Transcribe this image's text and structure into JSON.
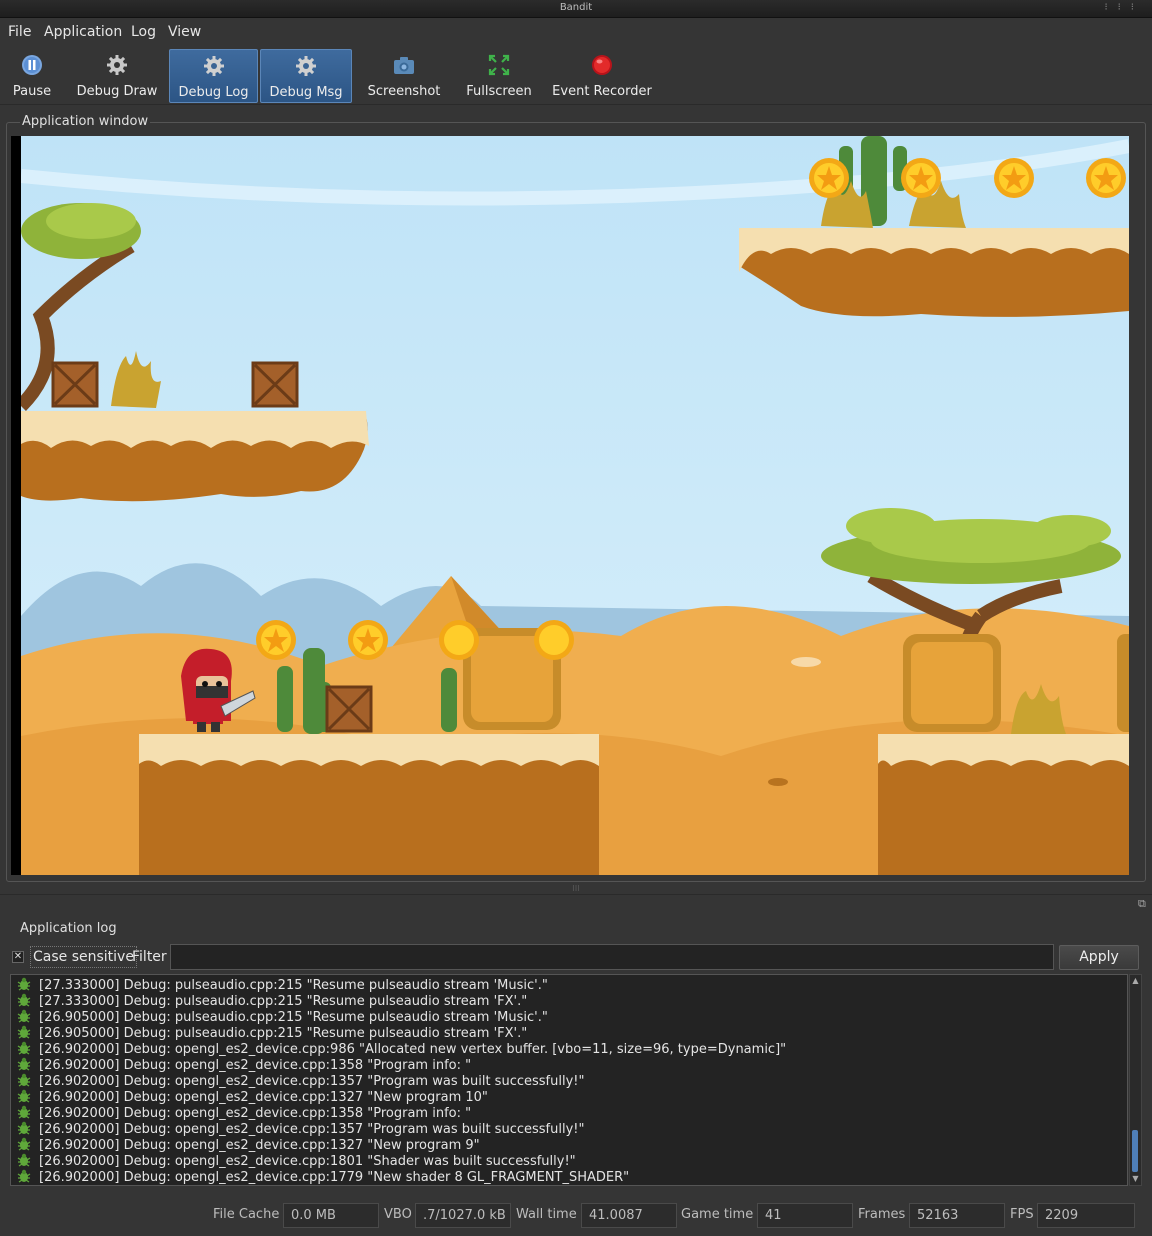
{
  "window": {
    "title": "Bandit"
  },
  "menu": [
    "File",
    "Application",
    "Log",
    "View"
  ],
  "toolbar": [
    {
      "label": "Pause",
      "icon": "pause-icon",
      "active": false
    },
    {
      "label": "Debug Draw",
      "icon": "gear-icon",
      "active": false
    },
    {
      "label": "Debug Log",
      "icon": "gear-icon",
      "active": true
    },
    {
      "label": "Debug Msg",
      "icon": "gear-icon",
      "active": true
    },
    {
      "label": "Screenshot",
      "icon": "camera-icon",
      "active": false
    },
    {
      "label": "Fullscreen",
      "icon": "fullscreen-icon",
      "active": false
    },
    {
      "label": "Event Recorder",
      "icon": "record-icon",
      "active": false
    }
  ],
  "app_window": {
    "title": "Application window"
  },
  "log": {
    "title": "Application log",
    "case_sensitive_label": "Case sensitive",
    "case_sensitive_checked": true,
    "filter_label": "Filter",
    "filter_value": "",
    "apply_label": "Apply",
    "entries": [
      "[27.333000] Debug: pulseaudio.cpp:215 \"Resume pulseaudio stream 'Music'.\"",
      "[27.333000] Debug: pulseaudio.cpp:215 \"Resume pulseaudio stream 'FX'.\"",
      "[26.905000] Debug: pulseaudio.cpp:215 \"Resume pulseaudio stream 'Music'.\"",
      "[26.905000] Debug: pulseaudio.cpp:215 \"Resume pulseaudio stream 'FX'.\"",
      "[26.902000] Debug: opengl_es2_device.cpp:986 \"Allocated new vertex buffer. [vbo=11, size=96, type=Dynamic]\"",
      "[26.902000] Debug: opengl_es2_device.cpp:1358 \"Program info: \"",
      "[26.902000] Debug: opengl_es2_device.cpp:1357 \"Program was built successfully!\"",
      "[26.902000] Debug: opengl_es2_device.cpp:1327 \"New program 10\"",
      "[26.902000] Debug: opengl_es2_device.cpp:1358 \"Program info: \"",
      "[26.902000] Debug: opengl_es2_device.cpp:1357 \"Program was built successfully!\"",
      "[26.902000] Debug: opengl_es2_device.cpp:1327 \"New program 9\"",
      "[26.902000] Debug: opengl_es2_device.cpp:1801 \"Shader was built successfully!\"",
      "[26.902000] Debug: opengl_es2_device.cpp:1779 \"New shader 8 GL_FRAGMENT_SHADER\""
    ]
  },
  "status": {
    "file_cache_label": "File Cache",
    "file_cache_value": "0.0 MB",
    "vbo_label": "VBO",
    "vbo_value": ".7/1027.0 kB",
    "wall_time_label": "Wall time",
    "wall_time_value": "41.0087",
    "game_time_label": "Game time",
    "game_time_value": "41",
    "frames_label": "Frames",
    "frames_value": "52163",
    "fps_label": "FPS",
    "fps_value": "2209"
  },
  "colors": {
    "accent": "#3f6b9e",
    "sky": "#bfe3f7",
    "sand": "#e7a33a",
    "ground": "#b86f1e"
  }
}
